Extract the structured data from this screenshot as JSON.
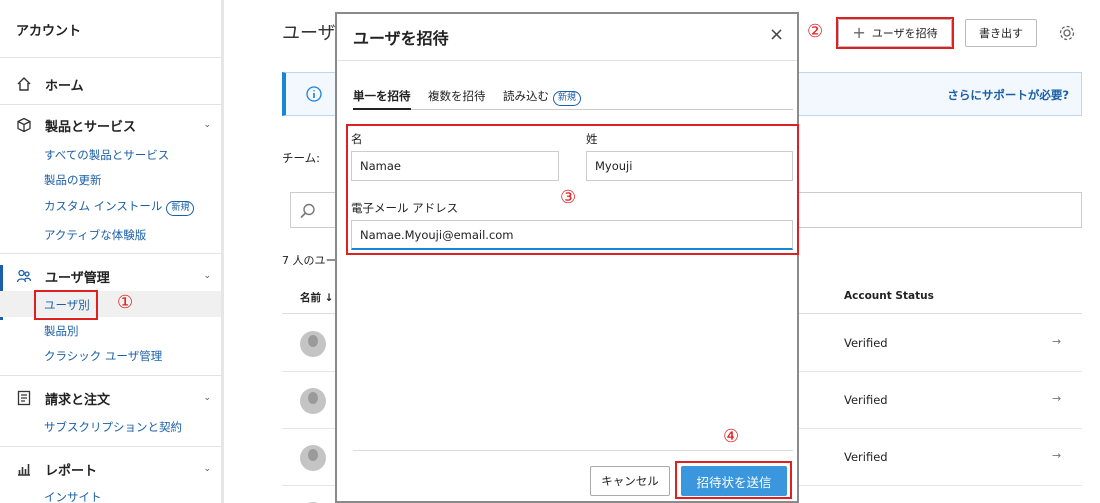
{
  "sidebar": {
    "title": "アカウント",
    "home": "ホーム",
    "products": {
      "label": "製品とサービス",
      "items": [
        "すべての製品とサービス",
        "製品の更新",
        "カスタム インストール",
        "アクティブな体験版"
      ],
      "new_badge": "新規"
    },
    "users": {
      "label": "ユーザ管理",
      "items": [
        "ユーザ別",
        "製品別",
        "クラシック ユーザ管理"
      ]
    },
    "billing": {
      "label": "請求と注文",
      "items": [
        "サブスクリプションと契約"
      ]
    },
    "reports": {
      "label": "レポート",
      "items": [
        "インサイト"
      ]
    }
  },
  "main": {
    "title": "ユーザ",
    "invite_button": "ユーザを招待",
    "export_button": "書き出す",
    "help_link": "さらにサポートが必要?",
    "team_label": "チーム:",
    "count_text": "7 人のユー",
    "table": {
      "col_name": "名前 ↓",
      "col_status": "Account Status",
      "rows": [
        {
          "status": "Verified"
        },
        {
          "status": "Verified"
        },
        {
          "status": "Verified"
        }
      ],
      "row_arrow": "→"
    }
  },
  "modal": {
    "title": "ユーザを招待",
    "close": "×",
    "tabs": [
      "単一を招待",
      "複数を招待",
      "読み込む"
    ],
    "tab_new_badge": "新規",
    "first_name_label": "名",
    "first_name_value": "Namae",
    "last_name_label": "姓",
    "last_name_value": "Myouji",
    "email_label": "電子メール アドレス",
    "email_value": "Namae.Myouji@email.com",
    "cancel_button": "キャンセル",
    "send_button": "招待状を送信"
  },
  "annotations": [
    "①",
    "②",
    "③",
    "④"
  ],
  "colors": {
    "accent": "#1a5fa8",
    "primary_button": "#3a96dd",
    "annotation": "#e02020"
  }
}
